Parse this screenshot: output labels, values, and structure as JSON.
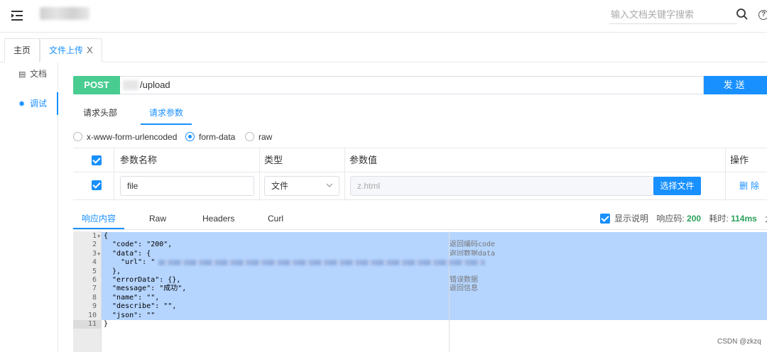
{
  "header": {
    "search_placeholder": "输入文档关键字搜索",
    "help_glyph": "?"
  },
  "tabs": [
    {
      "label": "主页"
    },
    {
      "label": "文件上传",
      "close": "X"
    }
  ],
  "sidebar": {
    "items": [
      {
        "label": "文档",
        "icon": "document-icon"
      },
      {
        "label": "调试",
        "icon": "bug-icon"
      }
    ]
  },
  "request": {
    "method": "POST",
    "url_path": "/upload",
    "send_label": "发送"
  },
  "request_tabs": {
    "headers": "请求头部",
    "params": "请求参数"
  },
  "body_types": [
    {
      "label": "x-www-form-urlencoded",
      "checked": false
    },
    {
      "label": "form-data",
      "checked": true
    },
    {
      "label": "raw",
      "checked": false
    }
  ],
  "params_table": {
    "headers": {
      "name": "参数名称",
      "type": "类型",
      "value": "参数值",
      "action": "操作"
    },
    "row": {
      "name": "file",
      "type": "文件",
      "value_placeholder": "z.html",
      "choose_label": "选择文件",
      "delete_label": "删除"
    }
  },
  "response": {
    "tabs": {
      "content": "响应内容",
      "raw": "Raw",
      "headers": "Headers",
      "curl": "Curl"
    },
    "show_desc_label": "显示说明",
    "code_label": "响应码:",
    "code_value": "200",
    "time_label": "耗时:",
    "time_value": "114ms",
    "size_label": "大小"
  },
  "code": {
    "line_numbers": [
      "1",
      "2",
      "3",
      "4",
      "5",
      "6",
      "7",
      "8",
      "9",
      "10",
      "11"
    ],
    "lines": [
      "{",
      "  \"code\": \"200\",",
      "  \"data\": {",
      "    \"url\": \"",
      "  },",
      "  \"errorData\": {},",
      "  \"message\": \"成功\",",
      "  \"name\": \"\",",
      "  \"describe\": \"\",",
      "  \"json\": \"\"",
      "}"
    ],
    "notes": {
      "code": "返回编码code",
      "data": "返回数据data",
      "errorData": "错误数据",
      "message": "返回信息"
    }
  },
  "watermark": "CSDN @zkzq",
  "colors": {
    "accent": "#1890ff",
    "post_method": "#49cc90",
    "selection": "#b5d5ff",
    "status_green": "#2aa15b"
  }
}
